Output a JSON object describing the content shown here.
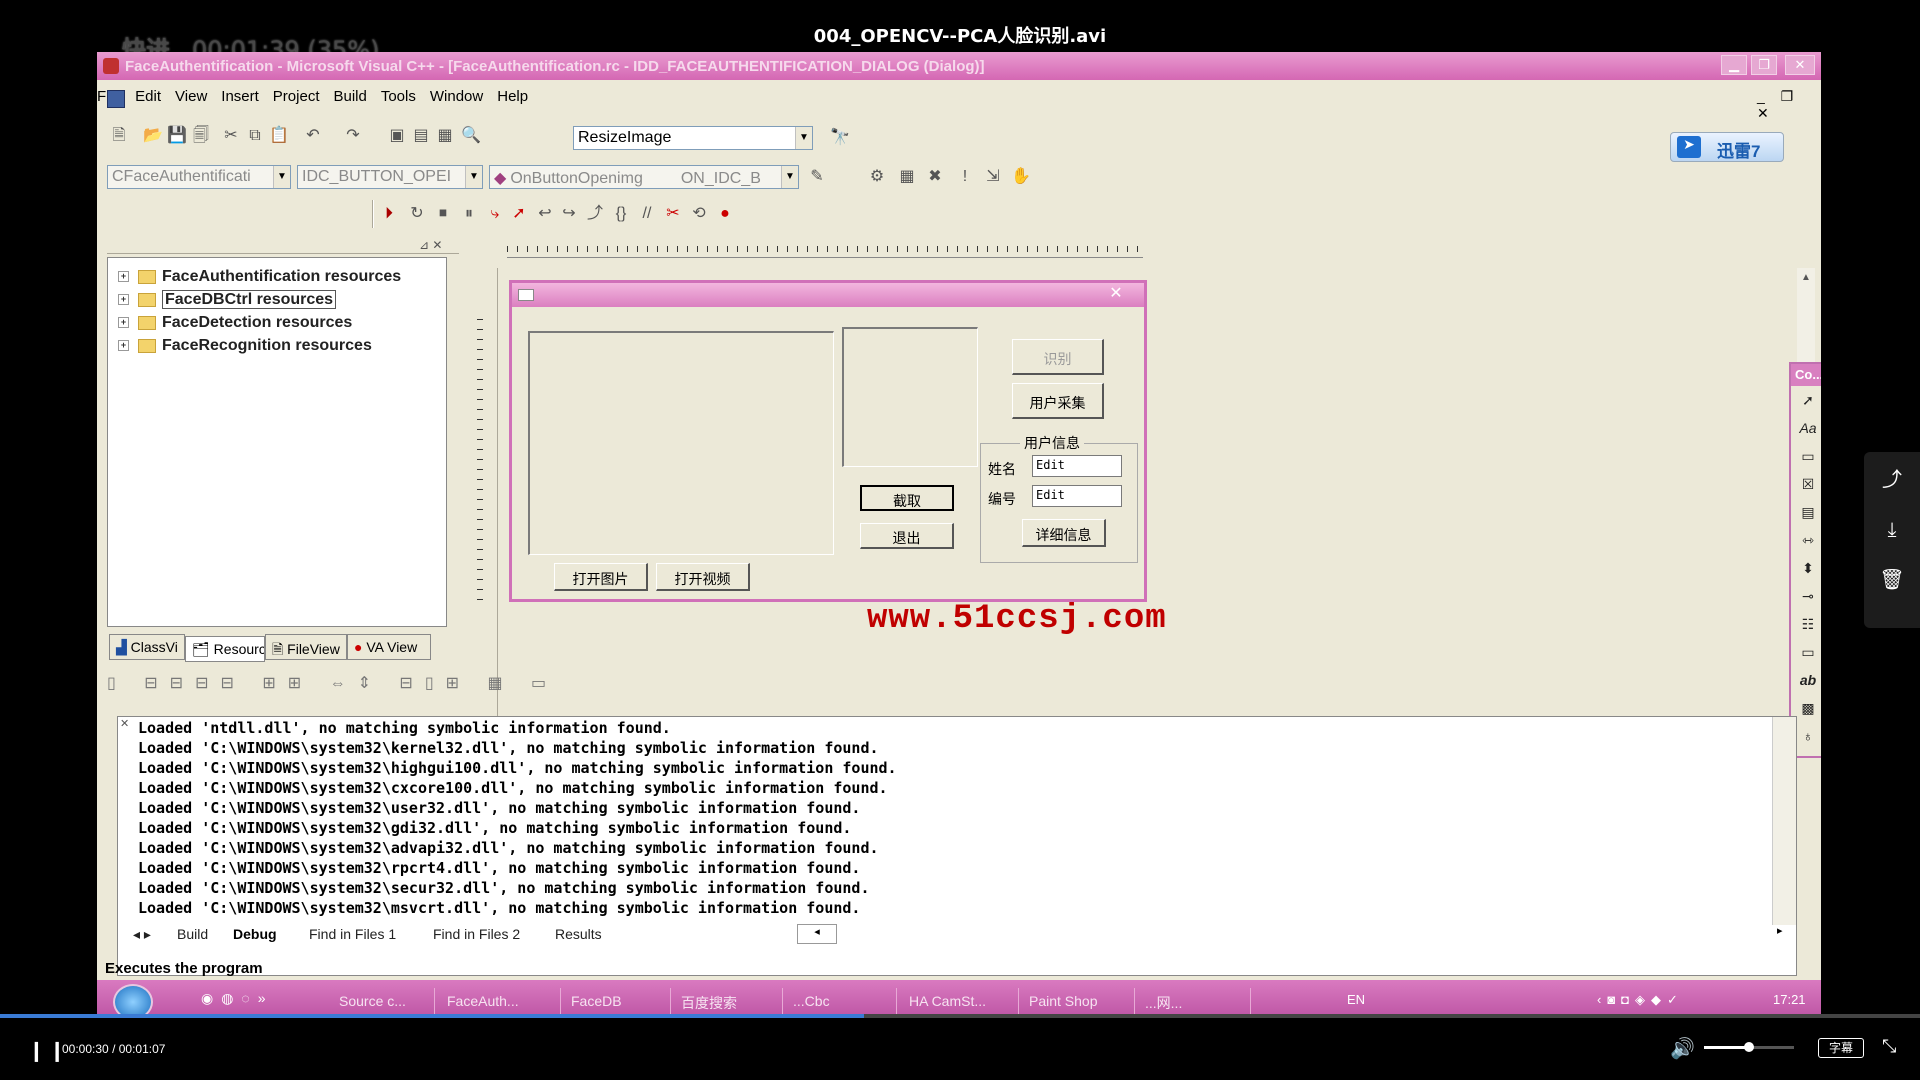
{
  "player": {
    "title": "004_OPENCV--PCA人脸识别.avi",
    "overlay_mode": "快进",
    "overlay_time": "00:01:39 (35%)",
    "current_time": "00:00:30",
    "total_time": "00:01:07",
    "time_separator": "/",
    "subtitle_label": "字幕",
    "progress": 0.45,
    "volume": 0.5,
    "side_buttons": [
      "share-icon",
      "download-icon",
      "delete-icon"
    ]
  },
  "window": {
    "title": "FaceAuthentification - Microsoft Visual C++ - [FaceAuthentification.rc - IDD_FACEAUTHENTIFICATION_DIALOG (Dialog)]",
    "menu": [
      "File",
      "Edit",
      "View",
      "Insert",
      "Project",
      "Build",
      "Tools",
      "Window",
      "Help"
    ],
    "combo_find": "ResizeImage",
    "combo_class": "CFaceAuthentificati",
    "combo_id": "IDC_BUTTON_OPEI",
    "combo_func": "OnButtonOpenimg",
    "combo_func2": "ON_IDC_B",
    "badge": "迅雷7"
  },
  "workspace": {
    "tree": [
      "FaceAuthentification resources",
      "FaceDBCtrl resources",
      "FaceDetection resources",
      "FaceRecognition resources"
    ],
    "tabs": [
      "ClassVi",
      "Resourc",
      "FileView",
      "VA View"
    ]
  },
  "dialog": {
    "btn_identify": "识别",
    "btn_collect": "用户采集",
    "group_title": "用户信息",
    "label_name": "姓名",
    "label_id": "编号",
    "edit_name": "Edit",
    "edit_id": "Edit",
    "btn_detail": "详细信息",
    "btn_capture": "截取",
    "btn_exit": "退出",
    "btn_open_image": "打开图片",
    "btn_open_video": "打开视频",
    "watermark": "www.51ccsj.com"
  },
  "controls_panel": {
    "title": "Co..."
  },
  "output": {
    "lines": [
      "Loaded 'ntdll.dll', no matching symbolic information found.",
      "Loaded 'C:\\WINDOWS\\system32\\kernel32.dll', no matching symbolic information found.",
      "Loaded 'C:\\WINDOWS\\system32\\highgui100.dll', no matching symbolic information found.",
      "Loaded 'C:\\WINDOWS\\system32\\cxcore100.dll', no matching symbolic information found.",
      "Loaded 'C:\\WINDOWS\\system32\\user32.dll', no matching symbolic information found.",
      "Loaded 'C:\\WINDOWS\\system32\\gdi32.dll', no matching symbolic information found.",
      "Loaded 'C:\\WINDOWS\\system32\\advapi32.dll', no matching symbolic information found.",
      "Loaded 'C:\\WINDOWS\\system32\\rpcrt4.dll', no matching symbolic information found.",
      "Loaded 'C:\\WINDOWS\\system32\\secur32.dll', no matching symbolic information found.",
      "Loaded 'C:\\WINDOWS\\system32\\msvcrt.dll', no matching symbolic information found."
    ],
    "tabs": [
      "Build",
      "Debug",
      "Find in Files 1",
      "Find in Files 2",
      "Results"
    ]
  },
  "status": {
    "text": "Executes the program"
  },
  "taskbar": {
    "items": [
      "Source c...",
      "FaceAuth...",
      "FaceDB",
      "百度搜索",
      "...Cbc",
      "HA CamSt...",
      "Paint Shop",
      "...网..."
    ],
    "lang": "EN",
    "clock": "17:21"
  }
}
